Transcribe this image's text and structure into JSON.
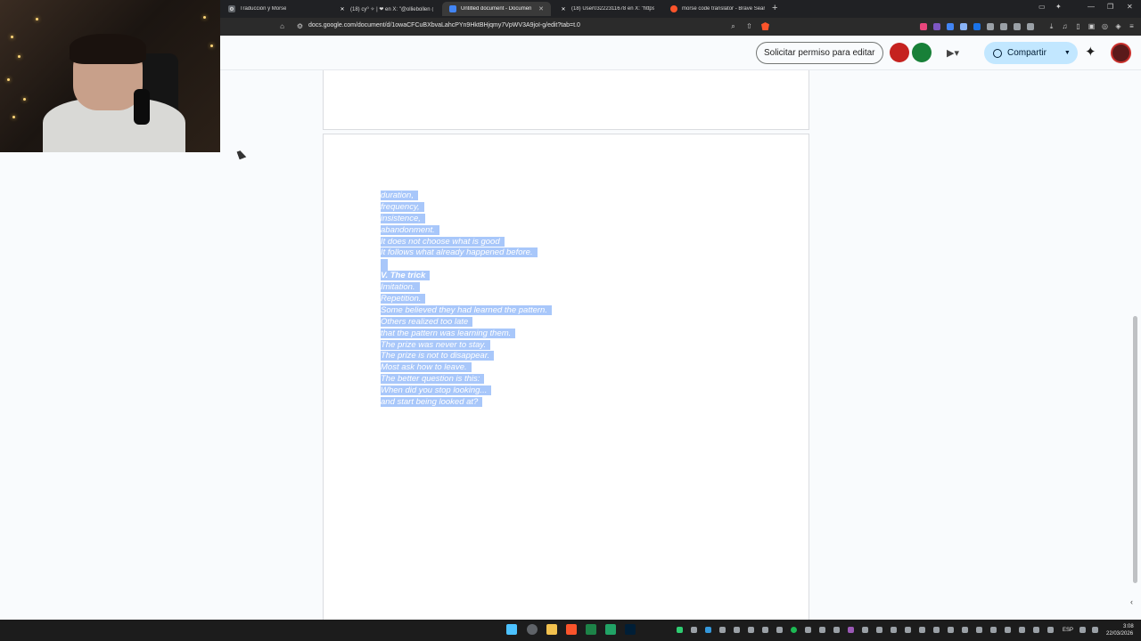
{
  "browser": {
    "tabs": [
      {
        "title": "Traducción y Morse",
        "icon": "translate-icon",
        "active": false
      },
      {
        "title": "(18) cy⁰ ✧ | ❤ en X: \"@olliebollen @",
        "icon": "x-logo-icon",
        "active": false
      },
      {
        "title": "Untitled document - Documen",
        "icon": "google-docs-icon",
        "active": true
      },
      {
        "title": "(18) User03222311678 en X: \"https://",
        "icon": "x-logo-icon",
        "active": false
      },
      {
        "title": "morse code translator - Brave Search",
        "icon": "brave-search-icon",
        "active": false
      }
    ],
    "url": "docs.google.com/document/d/1owaCFCuBXbvaLahcPYn9HktBHjqmy7VpWV3A9joI-g/edit?tab=t.0"
  },
  "docs_header": {
    "request_edit_label": "Solicitar permiso para editar",
    "share_label": "Compartir"
  },
  "document": {
    "lines": [
      {
        "text": "duration,",
        "bold": false
      },
      {
        "text": "frequency,",
        "bold": false
      },
      {
        "text": "insistence,",
        "bold": false
      },
      {
        "text": "abandonment.",
        "bold": false
      },
      {
        "text": "It does not choose what is good",
        "bold": false
      },
      {
        "text": "It follows what already happened before.",
        "bold": false
      },
      {
        "text": "",
        "bold": false
      },
      {
        "text": "V. The trick",
        "bold": true
      },
      {
        "text": "Imitation.",
        "bold": false
      },
      {
        "text": "Repetition.",
        "bold": false
      },
      {
        "text": "Some believed they had learned the pattern.",
        "bold": false
      },
      {
        "text": "Others realized too late",
        "bold": false
      },
      {
        "text": "that the pattern was learning them.",
        "bold": false
      },
      {
        "text": "The prize was never to stay.",
        "bold": false
      },
      {
        "text": "The prize is not to disappear.",
        "bold": false
      },
      {
        "text": "Most ask how to leave.",
        "bold": false
      },
      {
        "text": "The better question is this:",
        "bold": false
      },
      {
        "text": "When did you stop looking...",
        "bold": false
      },
      {
        "text": "and start being looked at?",
        "bold": false
      }
    ],
    "selection_color": "#a8c7fa"
  },
  "taskbar": {
    "language": "ESP",
    "time": "3:08",
    "date": "22/03/2026"
  },
  "colors": {
    "accent_share": "#c2e7ff",
    "tab_bar": "#202124",
    "doc_background": "#f9fbfd"
  }
}
